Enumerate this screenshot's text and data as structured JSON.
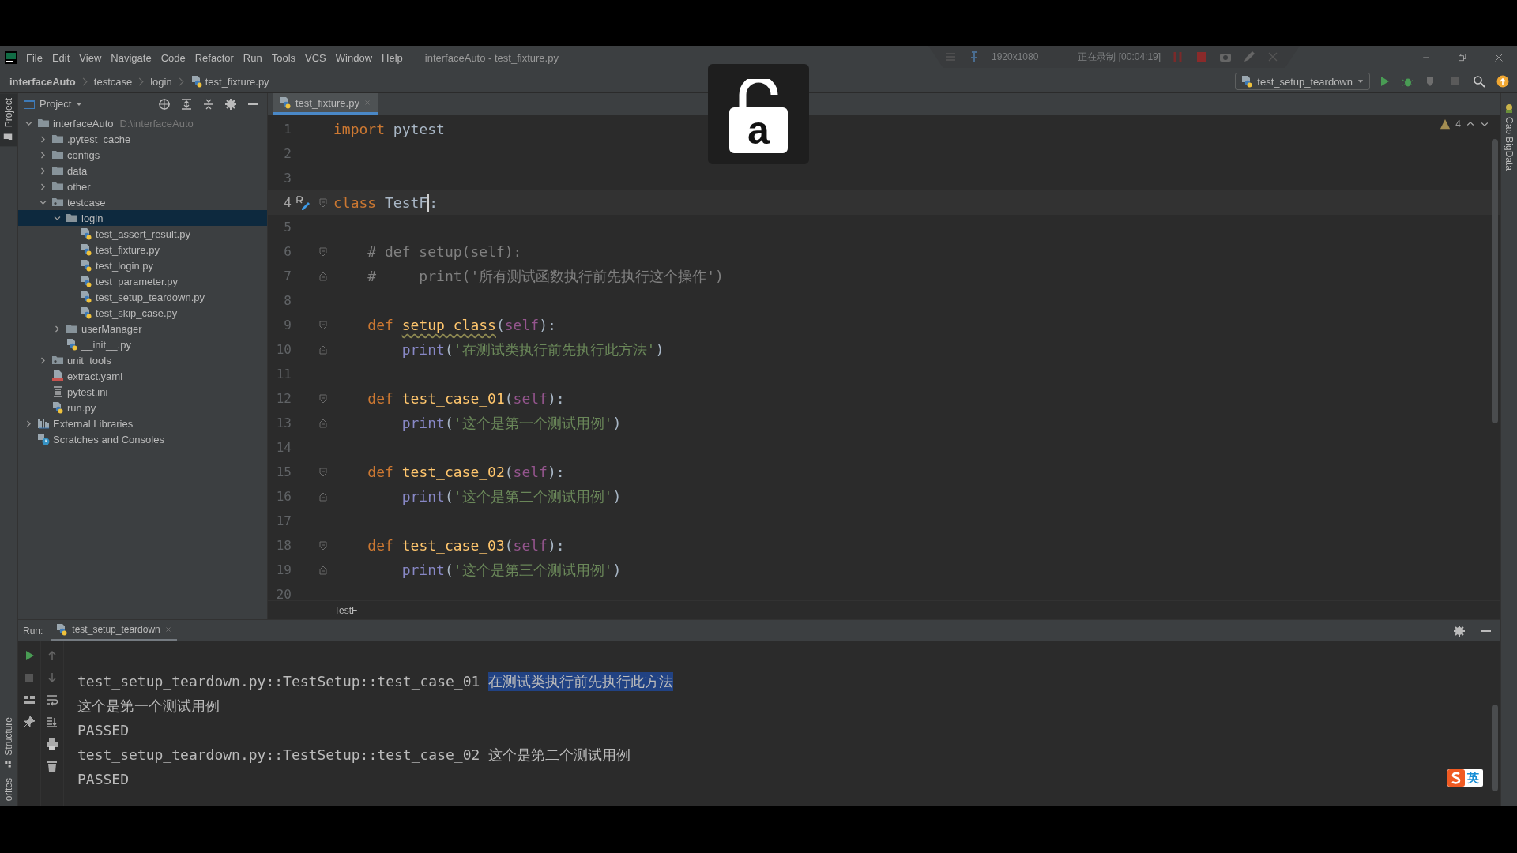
{
  "menu_bar": {
    "items": [
      "File",
      "Edit",
      "View",
      "Navigate",
      "Code",
      "Refactor",
      "Run",
      "Tools",
      "VCS",
      "Window",
      "Help"
    ],
    "title": "interfaceAuto - test_fixture.py"
  },
  "recorder": {
    "resolution": "1920x1080",
    "status": "正在录制 [00:04:19]"
  },
  "lock_overlay": {
    "key": "a"
  },
  "breadcrumbs": [
    {
      "label": "interfaceAuto",
      "kind": "project"
    },
    {
      "label": "testcase",
      "kind": "folder"
    },
    {
      "label": "login",
      "kind": "folder"
    },
    {
      "label": "test_fixture.py",
      "kind": "python"
    }
  ],
  "run_config": {
    "label": "test_setup_teardown"
  },
  "project_panel": {
    "title": "Project",
    "tree": [
      {
        "label": "interfaceAuto",
        "path": "D:\\interfaceAuto",
        "kind": "folder",
        "expanded": true,
        "selected": false,
        "children": [
          {
            "label": ".pytest_cache",
            "kind": "folder",
            "expanded": false,
            "selected": false
          },
          {
            "label": "configs",
            "kind": "folder",
            "expanded": false,
            "selected": false
          },
          {
            "label": "data",
            "kind": "folder",
            "expanded": false,
            "selected": false
          },
          {
            "label": "other",
            "kind": "folder",
            "expanded": false,
            "selected": false
          },
          {
            "label": "testcase",
            "kind": "package",
            "expanded": true,
            "selected": false,
            "children": [
              {
                "label": "login",
                "kind": "folder",
                "expanded": true,
                "selected": true,
                "children": [
                  {
                    "label": "test_assert_result.py",
                    "kind": "python",
                    "selected": false
                  },
                  {
                    "label": "test_fixture.py",
                    "kind": "python",
                    "selected": false
                  },
                  {
                    "label": "test_login.py",
                    "kind": "python",
                    "selected": false
                  },
                  {
                    "label": "test_parameter.py",
                    "kind": "python",
                    "selected": false
                  },
                  {
                    "label": "test_setup_teardown.py",
                    "kind": "python",
                    "selected": false
                  },
                  {
                    "label": "test_skip_case.py",
                    "kind": "python",
                    "selected": false
                  }
                ]
              },
              {
                "label": "userManager",
                "kind": "folder",
                "expanded": false,
                "selected": false
              },
              {
                "label": "__init__.py",
                "kind": "python",
                "selected": false
              }
            ]
          },
          {
            "label": "unit_tools",
            "kind": "package",
            "expanded": false,
            "selected": false
          },
          {
            "label": "extract.yaml",
            "kind": "yaml",
            "selected": false
          },
          {
            "label": "pytest.ini",
            "kind": "ini",
            "selected": false
          },
          {
            "label": "run.py",
            "kind": "python",
            "selected": false
          }
        ]
      },
      {
        "label": "External Libraries",
        "kind": "libraries",
        "expanded": false,
        "selected": false
      },
      {
        "label": "Scratches and Consoles",
        "kind": "scratches",
        "selected": false
      }
    ]
  },
  "editor": {
    "tabs": [
      {
        "label": "test_fixture.py",
        "selected": true
      }
    ],
    "problems": "4",
    "breadcrumb": "TestF",
    "lines": [
      {
        "number": "1",
        "current": false,
        "tokens": [
          {
            "kind": "keyword",
            "text": "import"
          },
          {
            "kind": "plain",
            "text": " pytest"
          }
        ]
      },
      {
        "number": "2",
        "current": false
      },
      {
        "number": "3",
        "current": false
      },
      {
        "number": "4",
        "current": true,
        "modified": true,
        "fold_start": true,
        "tokens": [
          {
            "kind": "keyword",
            "text": "class"
          },
          {
            "kind": "plain",
            "text": " TestF",
            "caret": true
          },
          {
            "kind": "plain",
            "text": ":"
          }
        ]
      },
      {
        "number": "5",
        "current": false
      },
      {
        "number": "6",
        "current": false,
        "fold_start": true,
        "tokens": [
          {
            "kind": "comment",
            "text": "    # def setup(self):"
          }
        ]
      },
      {
        "number": "7",
        "current": false,
        "fold_end": true,
        "tokens": [
          {
            "kind": "comment",
            "text": "    #     print('所有测试函数执行前先执行这个操作')"
          }
        ]
      },
      {
        "number": "8",
        "current": false
      },
      {
        "number": "9",
        "current": false,
        "fold_start": true,
        "tokens": [
          {
            "kind": "keyword",
            "text": "    def "
          },
          {
            "kind": "func",
            "text": "setup_class",
            "underlined": true
          },
          {
            "kind": "plain",
            "text": "("
          },
          {
            "kind": "self",
            "text": "self"
          },
          {
            "kind": "plain",
            "text": "):"
          }
        ]
      },
      {
        "number": "10",
        "current": false,
        "fold_end": true,
        "tokens": [
          {
            "kind": "builtin",
            "text": "        print"
          },
          {
            "kind": "plain",
            "text": "("
          },
          {
            "kind": "string",
            "text": "'在测试类执行前先执行此方法'"
          },
          {
            "kind": "plain",
            "text": ")"
          }
        ]
      },
      {
        "number": "11",
        "current": false
      },
      {
        "number": "12",
        "current": false,
        "fold_start": true,
        "tokens": [
          {
            "kind": "keyword",
            "text": "    def "
          },
          {
            "kind": "func",
            "text": "test_case_01"
          },
          {
            "kind": "plain",
            "text": "("
          },
          {
            "kind": "self",
            "text": "self"
          },
          {
            "kind": "plain",
            "text": "):"
          }
        ]
      },
      {
        "number": "13",
        "current": false,
        "fold_end": true,
        "tokens": [
          {
            "kind": "builtin",
            "text": "        print"
          },
          {
            "kind": "plain",
            "text": "("
          },
          {
            "kind": "string",
            "text": "'这个是第一个测试用例'"
          },
          {
            "kind": "plain",
            "text": ")"
          }
        ]
      },
      {
        "number": "14",
        "current": false
      },
      {
        "number": "15",
        "current": false,
        "fold_start": true,
        "tokens": [
          {
            "kind": "keyword",
            "text": "    def "
          },
          {
            "kind": "func",
            "text": "test_case_02"
          },
          {
            "kind": "plain",
            "text": "("
          },
          {
            "kind": "self",
            "text": "self"
          },
          {
            "kind": "plain",
            "text": "):"
          }
        ]
      },
      {
        "number": "16",
        "current": false,
        "fold_end": true,
        "tokens": [
          {
            "kind": "builtin",
            "text": "        print"
          },
          {
            "kind": "plain",
            "text": "("
          },
          {
            "kind": "string",
            "text": "'这个是第二个测试用例'"
          },
          {
            "kind": "plain",
            "text": ")"
          }
        ]
      },
      {
        "number": "17",
        "current": false
      },
      {
        "number": "18",
        "current": false,
        "fold_start": true,
        "tokens": [
          {
            "kind": "keyword",
            "text": "    def "
          },
          {
            "kind": "func",
            "text": "test_case_03"
          },
          {
            "kind": "plain",
            "text": "("
          },
          {
            "kind": "self",
            "text": "self"
          },
          {
            "kind": "plain",
            "text": "):"
          }
        ]
      },
      {
        "number": "19",
        "current": false,
        "fold_end": true,
        "tokens": [
          {
            "kind": "builtin",
            "text": "        print"
          },
          {
            "kind": "plain",
            "text": "("
          },
          {
            "kind": "string",
            "text": "'这个是第三个测试用例'"
          },
          {
            "kind": "plain",
            "text": ")"
          }
        ]
      },
      {
        "number": "20",
        "current": false
      }
    ]
  },
  "run_panel": {
    "label": "Run:",
    "tabs": [
      {
        "label": "test_setup_teardown",
        "selected": true
      }
    ],
    "console": [
      {
        "text": "test_setup_teardown.py::TestSetup::test_case_01 ",
        "message": "在测试类执行前先执行此方法",
        "selected": true
      },
      {
        "text": "这个是第一个测试用例"
      },
      {
        "text": "PASSED"
      },
      {
        "text": "test_setup_teardown.py::TestSetup::test_case_02 ",
        "message": "这个是第二个测试用例",
        "selected": false
      },
      {
        "text": "PASSED"
      }
    ]
  },
  "side_stripes": {
    "left_top": "Project",
    "left_bottom": [
      "Structure",
      "orites"
    ],
    "right": "Cap BigData"
  },
  "ime": {
    "mode": "英"
  }
}
